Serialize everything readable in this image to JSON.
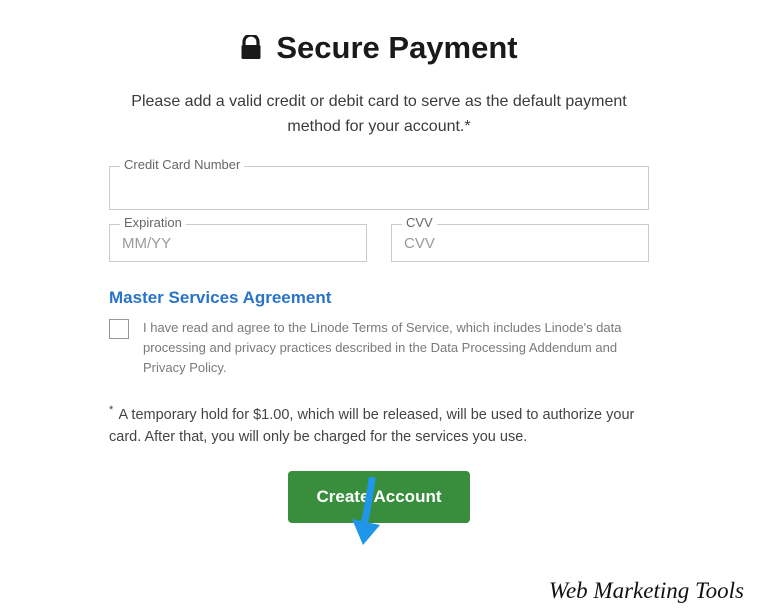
{
  "header": {
    "title": "Secure Payment",
    "instruction": "Please add a valid credit or debit card to serve as the default payment method for your account.*"
  },
  "fields": {
    "card": {
      "label": "Credit Card Number",
      "value": "",
      "placeholder": ""
    },
    "exp": {
      "label": "Expiration",
      "value": "",
      "placeholder": "MM/YY"
    },
    "cvv": {
      "label": "CVV",
      "value": "",
      "placeholder": "CVV"
    }
  },
  "agreement": {
    "heading": "Master Services Agreement",
    "text": "I have read and agree to the Linode Terms of Service, which includes Linode's data processing and privacy practices described in the Data Processing Addendum and Privacy Policy.",
    "checked": false
  },
  "footnote": {
    "marker": "*",
    "text": "A temporary hold for $1.00, which will be released, will be used to authorize your card. After that, you will only be charged for the services you use."
  },
  "submit": {
    "label": "Create Account"
  },
  "watermark": "Web Marketing Tools",
  "colors": {
    "link": "#2a74c7",
    "button": "#388e3c"
  }
}
